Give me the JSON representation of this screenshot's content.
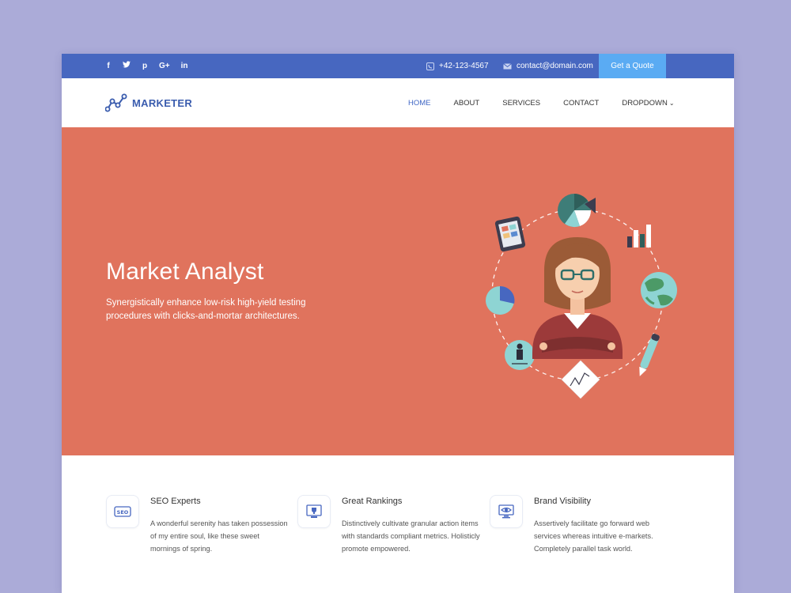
{
  "topbar": {
    "social": [
      {
        "icon": "facebook-icon",
        "glyph": "f"
      },
      {
        "icon": "twitter-icon",
        "glyph": "t"
      },
      {
        "icon": "pinterest-icon",
        "glyph": "p"
      },
      {
        "icon": "google-plus-icon",
        "glyph": "G+"
      },
      {
        "icon": "linkedin-icon",
        "glyph": "in"
      }
    ],
    "phone": "+42-123-4567",
    "email": "contact@domain.com",
    "quote_label": "Get a Quote",
    "color": "#4767c0",
    "quote_color": "#5aabf3"
  },
  "brand": {
    "name": "MARKETER",
    "logo_icon": "chart-line-icon"
  },
  "nav": {
    "items": [
      {
        "label": "HOME"
      },
      {
        "label": "ABOUT"
      },
      {
        "label": "SERVICES"
      },
      {
        "label": "CONTACT"
      },
      {
        "label": "DROPDOWN"
      }
    ],
    "active_index": 0
  },
  "hero": {
    "title": "Market Analyst",
    "subtitle": "Synergistically enhance low-risk high-yield testing procedures with clicks-and-mortar architectures.",
    "bg_color": "#e0735d"
  },
  "features": [
    {
      "icon": "seo-icon",
      "title": "SEO Experts",
      "text": "A wonderful serenity has taken possession of my entire soul, like these sweet mornings of spring."
    },
    {
      "icon": "ranking-trophy-icon",
      "title": "Great Rankings",
      "text": "Distinctively cultivate granular action items with standards compliant metrics. Holisticly promote empowered."
    },
    {
      "icon": "eye-monitor-icon",
      "title": "Brand Visibility",
      "text": "Assertively facilitate go forward web services whereas intuitive e-markets. Completely parallel task world."
    }
  ]
}
